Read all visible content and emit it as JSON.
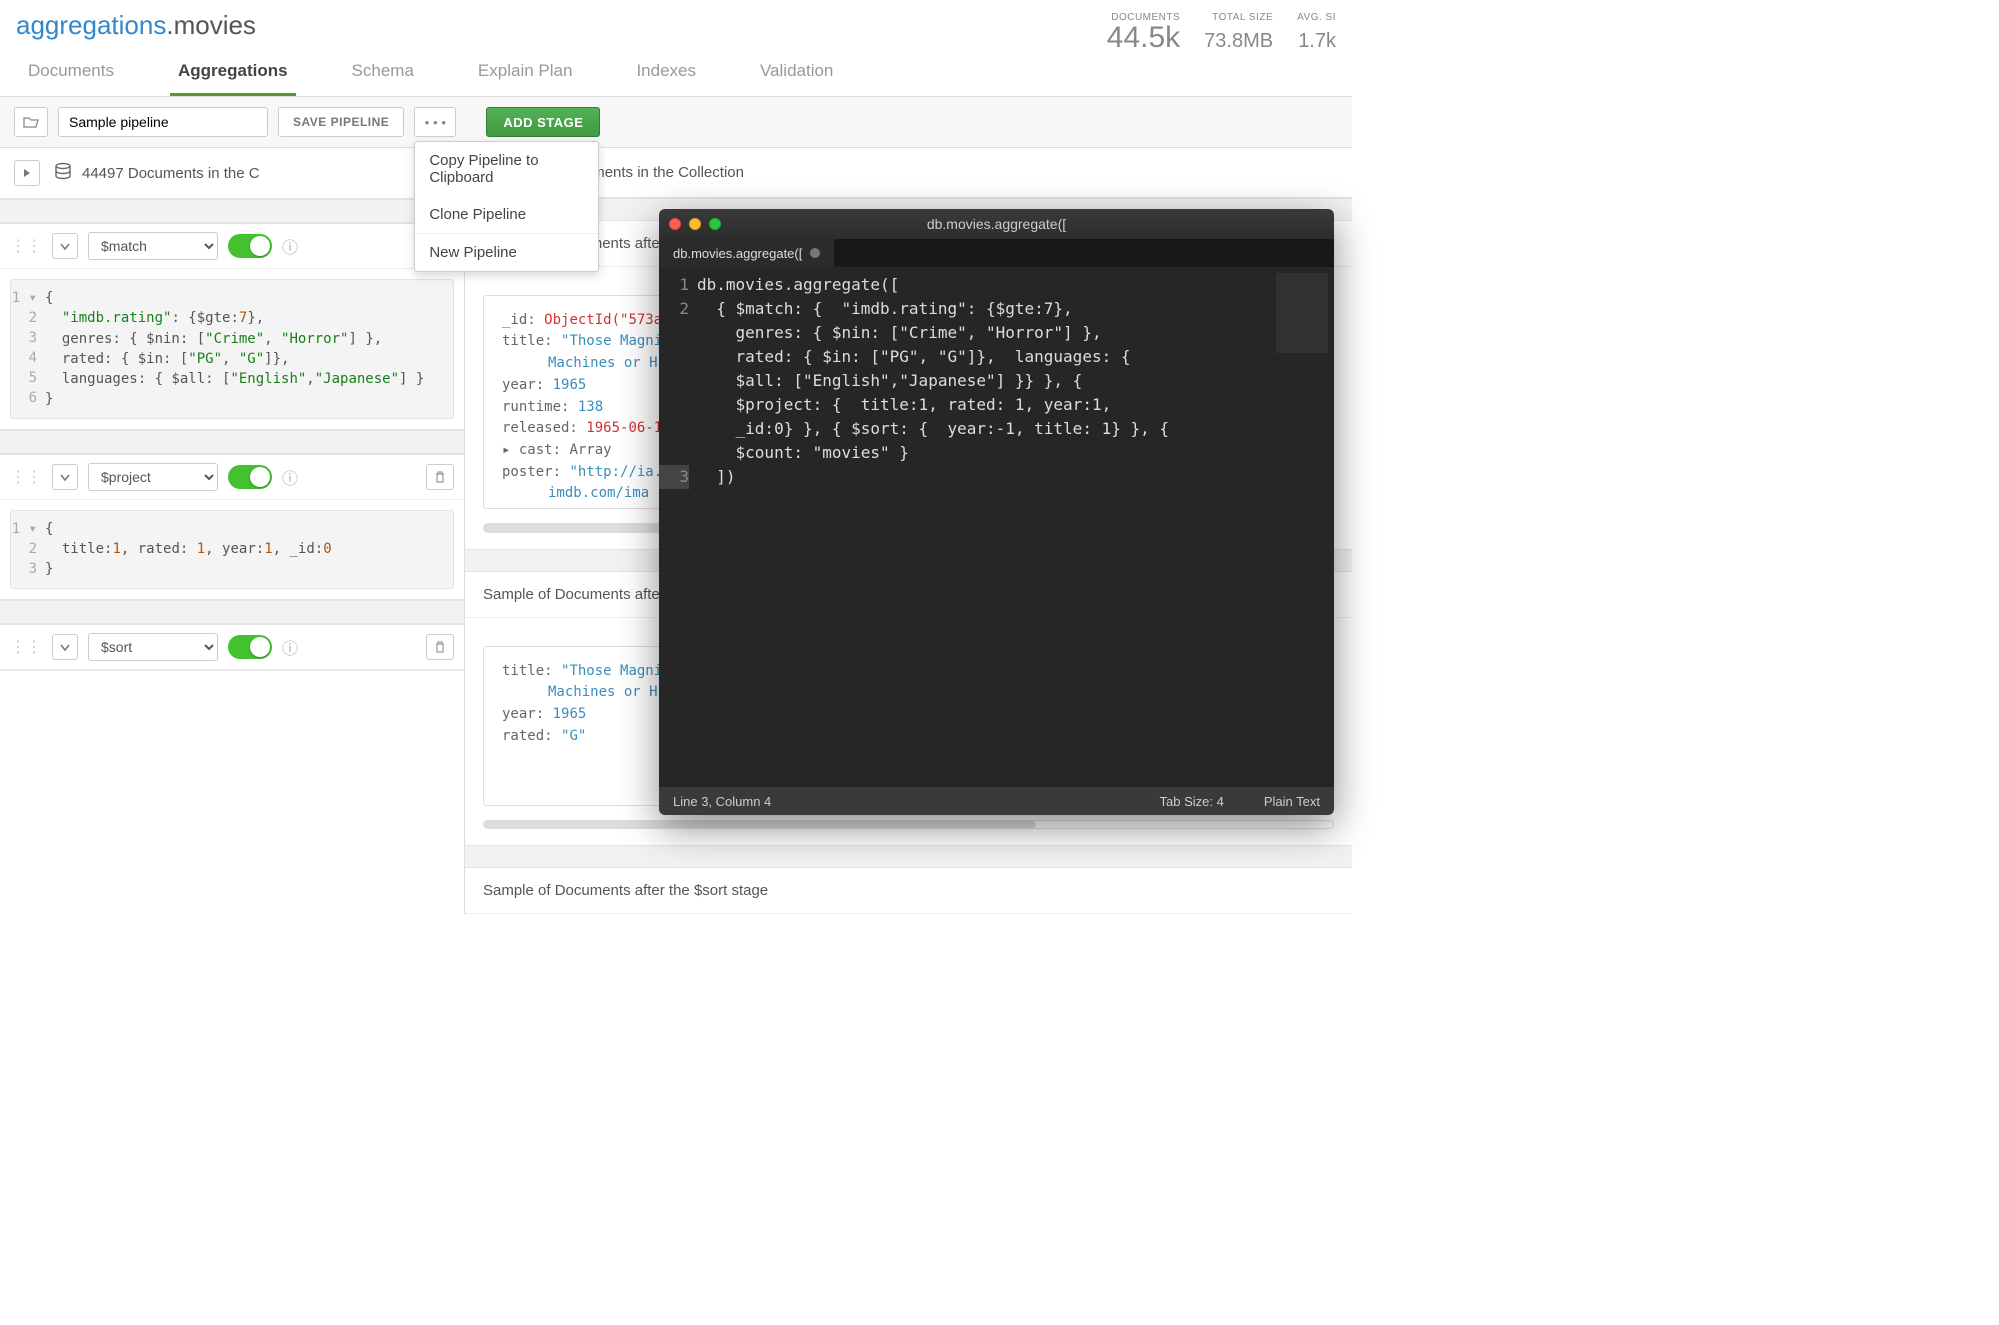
{
  "breadcrumb": {
    "db": "aggregations",
    "collection": "movies"
  },
  "stats": {
    "documents_label": "DOCUMENTS",
    "documents_value": "44.5k",
    "total_size_label": "TOTAL SIZE",
    "total_size_value": "73.8MB",
    "avg_size_label": "AVG. SI",
    "avg_size_value": "1.7k"
  },
  "tabs": [
    "Documents",
    "Aggregations",
    "Schema",
    "Explain Plan",
    "Indexes",
    "Validation"
  ],
  "active_tab": 1,
  "toolbar": {
    "pipeline_name": "Sample pipeline",
    "save_label": "SAVE PIPELINE",
    "add_stage_label": "ADD STAGE"
  },
  "dropdown": {
    "items": [
      "Copy Pipeline to Clipboard",
      "Clone Pipeline",
      "New Pipeline"
    ]
  },
  "left": {
    "doc_count_text": "44497 Documents in the C",
    "stages": [
      {
        "operator": "$match",
        "code_lines": [
          "{",
          "  \"imdb.rating\": {$gte:7},",
          "  genres: { $nin: [\"Crime\", \"Horror\"] },",
          "  rated: { $in: [\"PG\", \"G\"]},",
          "  languages: { $all: [\"English\",\"Japanese\"] }",
          "}"
        ]
      },
      {
        "operator": "$project",
        "code_lines": [
          "{",
          "  title:1, rated: 1, year:1, _id:0",
          "}"
        ]
      },
      {
        "operator": "$sort",
        "code_lines": []
      }
    ]
  },
  "right": {
    "preview_header": "Preview of Documents in the Collection",
    "stage_headers": [
      "Sample of Documents after the $match stage",
      "Sample of Documents after the",
      "Sample of Documents after the $sort stage"
    ],
    "doc1": {
      "id_key": "_id:",
      "id_val": "ObjectId(\"573a1",
      "title_key": "title:",
      "title_val": "\"Those Magnif",
      "title_cont": "Machines or H",
      "year_key": "year:",
      "year_val": "1965",
      "runtime_key": "runtime:",
      "runtime_val": "138",
      "released_key": "released:",
      "released_val": "1965-06-15",
      "cast_key": "cast:",
      "cast_val": "Array",
      "poster_key": "poster:",
      "poster_val": "\"http://ia.m",
      "poster_cont": "imdb.com/ima"
    },
    "doc2": {
      "title_key": "title:",
      "title_val": "\"Those Magnif",
      "title_cont": "Machines or H",
      "year_key": "year:",
      "year_val": "1965",
      "rated_key": "rated:",
      "rated_val": "\"G\""
    }
  },
  "terminal": {
    "title": "db.movies.aggregate([",
    "tab": "db.movies.aggregate([",
    "lines": [
      "db.movies.aggregate([",
      "  { $match: {  \"imdb.rating\": {$gte:7},\n    genres: { $nin: [\"Crime\", \"Horror\"] },\n    rated: { $in: [\"PG\", \"G\"]},  languages: {\n    $all: [\"English\",\"Japanese\"] }} }, {\n    $project: {  title:1, rated: 1, year:1,\n    _id:0} }, { $sort: {  year:-1, title: 1} }, {\n    $count: \"movies\" }",
      "  ])"
    ],
    "status_left": "Line 3, Column 4",
    "status_tab": "Tab Size: 4",
    "status_mode": "Plain Text"
  }
}
